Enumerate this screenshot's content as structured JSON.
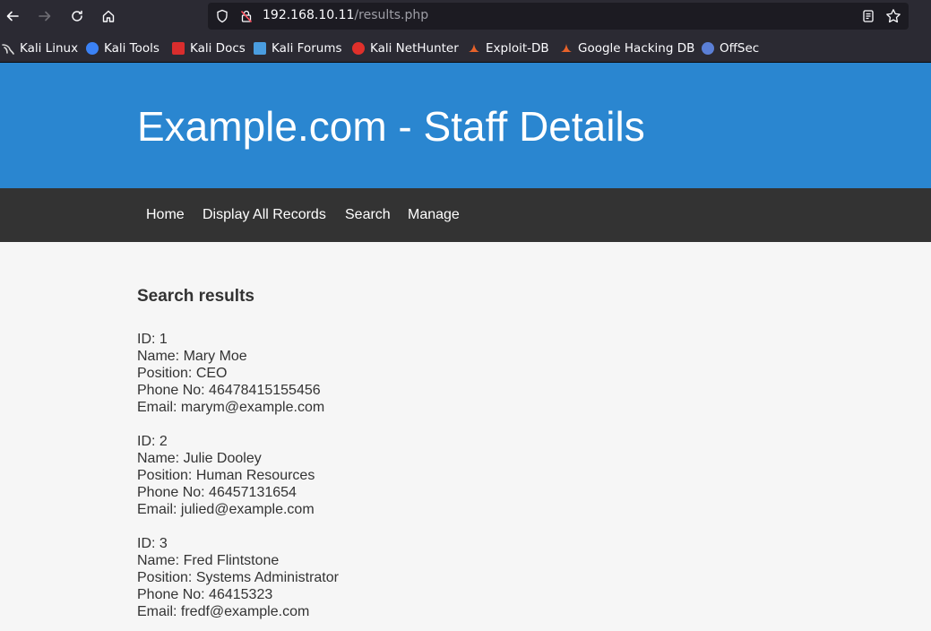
{
  "browser": {
    "url_host": "192.168.10.11",
    "url_path": "/results.php",
    "bookmarks": [
      {
        "label": "Kali Linux",
        "icon": "kali-dragon-icon",
        "color": "#d9d9d9"
      },
      {
        "label": "Kali Tools",
        "icon": "kali-tools-icon",
        "color": "#3b82f6"
      },
      {
        "label": "Kali Docs",
        "icon": "kali-docs-icon",
        "color": "#d92d2d"
      },
      {
        "label": "Kali Forums",
        "icon": "kali-forums-icon",
        "color": "#4a9de0"
      },
      {
        "label": "Kali NetHunter",
        "icon": "kali-nethunter-icon",
        "color": "#e0302b"
      },
      {
        "label": "Exploit-DB",
        "icon": "exploit-db-icon",
        "color": "#e8622a"
      },
      {
        "label": "Google Hacking DB",
        "icon": "ghdb-icon",
        "color": "#e8622a"
      },
      {
        "label": "OffSec",
        "icon": "offsec-icon",
        "color": "#5b7fd6"
      }
    ]
  },
  "header": {
    "title": "Example.com - Staff Details",
    "bg_color": "#2a86d0"
  },
  "nav": {
    "items": [
      "Home",
      "Display All Records",
      "Search",
      "Manage"
    ]
  },
  "main": {
    "heading": "Search results",
    "records": [
      {
        "id": "ID: 1",
        "name": "Name: Mary Moe",
        "position": "Position: CEO",
        "phone": "Phone No: 46478415155456",
        "email": "Email: marym@example.com"
      },
      {
        "id": "ID: 2",
        "name": "Name: Julie Dooley",
        "position": "Position: Human Resources",
        "phone": "Phone No: 46457131654",
        "email": "Email: julied@example.com"
      },
      {
        "id": "ID: 3",
        "name": "Name: Fred Flintstone",
        "position": "Position: Systems Administrator",
        "phone": "Phone No: 46415323",
        "email": "Email: fredf@example.com"
      }
    ]
  }
}
